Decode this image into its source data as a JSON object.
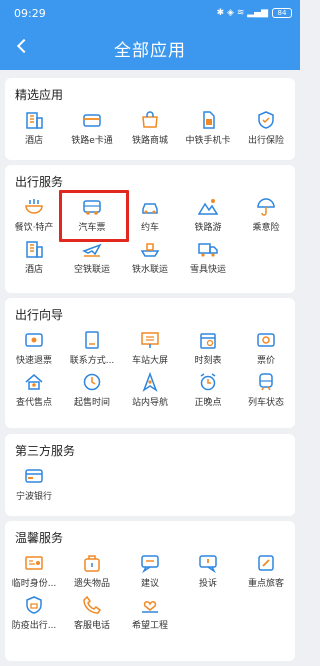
{
  "status": {
    "time": "09:29",
    "indicators": "✱  ◈  ≋  ▂▄▆",
    "battery": "84"
  },
  "header": {
    "title": "全部应用"
  },
  "sections": [
    {
      "title": "精选应用",
      "items": [
        {
          "label": "酒店",
          "icon": "building-icon"
        },
        {
          "label": "铁路e卡通",
          "icon": "card-icon"
        },
        {
          "label": "铁路商城",
          "icon": "shop-icon"
        },
        {
          "label": "中铁手机卡",
          "icon": "sim-card-icon"
        },
        {
          "label": "出行保险",
          "icon": "shield-icon"
        }
      ]
    },
    {
      "title": "出行服务",
      "items": [
        {
          "label": "餐饮·特产",
          "icon": "food-bowl-icon"
        },
        {
          "label": "汽车票",
          "icon": "bus-icon"
        },
        {
          "label": "约车",
          "icon": "car-icon"
        },
        {
          "label": "铁路游",
          "icon": "mountain-icon"
        },
        {
          "label": "乘意险",
          "icon": "umbrella-icon"
        },
        {
          "label": "酒店",
          "icon": "building-icon"
        },
        {
          "label": "空铁联运",
          "icon": "plane-icon"
        },
        {
          "label": "铁水联运",
          "icon": "ship-icon"
        },
        {
          "label": "雪具快运",
          "icon": "truck-icon"
        }
      ]
    },
    {
      "title": "出行向导",
      "items": [
        {
          "label": "快速退票",
          "icon": "ticket-icon"
        },
        {
          "label": "联系方式...",
          "icon": "phone-book-icon"
        },
        {
          "label": "车站大屏",
          "icon": "screen-icon"
        },
        {
          "label": "时刻表",
          "icon": "calendar-icon"
        },
        {
          "label": "票价",
          "icon": "price-icon"
        },
        {
          "label": "查代售点",
          "icon": "house-icon"
        },
        {
          "label": "起售时间",
          "icon": "clock-icon"
        },
        {
          "label": "站内导航",
          "icon": "navigation-icon"
        },
        {
          "label": "正晚点",
          "icon": "alarm-icon"
        },
        {
          "label": "列车状态",
          "icon": "train-icon"
        }
      ]
    },
    {
      "title": "第三方服务",
      "items": [
        {
          "label": "宁波银行",
          "icon": "bank-icon"
        }
      ]
    },
    {
      "title": "温馨服务",
      "items": [
        {
          "label": "临时身份...",
          "icon": "id-card-icon"
        },
        {
          "label": "遗失物品",
          "icon": "lost-item-icon"
        },
        {
          "label": "建议",
          "icon": "suggestion-icon"
        },
        {
          "label": "投诉",
          "icon": "complaint-icon"
        },
        {
          "label": "重点旅客",
          "icon": "key-passenger-icon"
        },
        {
          "label": "防疫出行...",
          "icon": "mask-shield-icon"
        },
        {
          "label": "客服电话",
          "icon": "phone-icon"
        },
        {
          "label": "希望工程",
          "icon": "heart-hand-icon"
        }
      ]
    }
  ],
  "colors": {
    "header": "#3b98ee",
    "icon_blue": "#2e86de",
    "icon_orange": "#f08a24",
    "highlight": "#e0281f"
  }
}
